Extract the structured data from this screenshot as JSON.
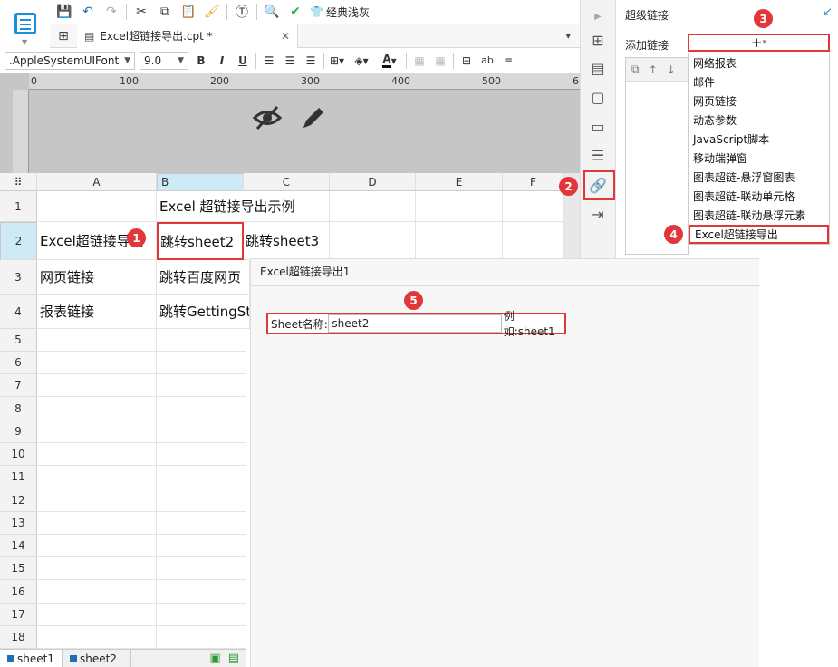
{
  "toolbar": {
    "style_label": "经典浅灰"
  },
  "tab": {
    "title": "Excel超链接导出.cpt *"
  },
  "format": {
    "font": ".AppleSystemUIFont",
    "size": "9.0"
  },
  "ruler": {
    "labels": [
      "0",
      "100",
      "200",
      "300",
      "400",
      "500",
      "6"
    ]
  },
  "grid": {
    "columns": [
      "A",
      "B",
      "C",
      "D",
      "E",
      "F"
    ],
    "rows": [
      "1",
      "2",
      "3",
      "4",
      "5",
      "6",
      "7",
      "8",
      "9",
      "10",
      "11",
      "12",
      "13",
      "14",
      "15",
      "16",
      "17",
      "18"
    ],
    "cells": {
      "b1": "Excel 超链接导出示例",
      "a2": "Excel超链接导出",
      "b2": "跳转sheet2",
      "c2": "跳转sheet3",
      "a3": "网页链接",
      "b3": "跳转百度网页",
      "a4": "报表链接",
      "b4": "跳转GettingStarted"
    }
  },
  "sheets": [
    "sheet1",
    "sheet2"
  ],
  "panel": {
    "title": "超级链接",
    "add_label": "添加链接",
    "add_symbol": "+",
    "menu_items": [
      "网络报表",
      "邮件",
      "网页链接",
      "动态参数",
      "JavaScript脚本",
      "移动端弹窗",
      "图表超链-悬浮窗图表",
      "图表超链-联动单元格",
      "图表超链-联动悬浮元素",
      "Excel超链接导出"
    ]
  },
  "dialog": {
    "title": "Excel超链接导出1",
    "field_label": "Sheet名称:",
    "field_value": "sheet2",
    "field_hint": "例如:sheet1"
  },
  "badges": [
    "1",
    "2",
    "3",
    "4",
    "5"
  ],
  "colors": {
    "accent": "#1a8ed6",
    "highlight": "#e2363b",
    "selected_header": "#cdeaf6"
  }
}
